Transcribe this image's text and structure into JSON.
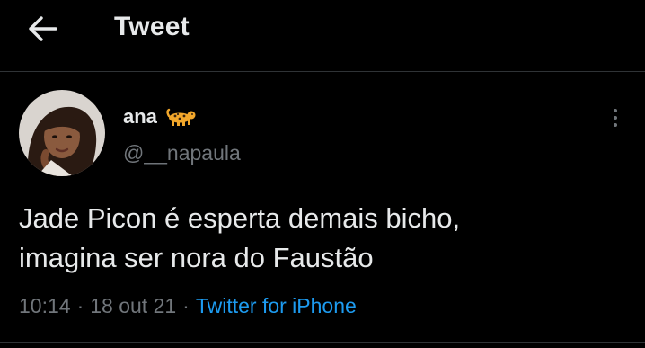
{
  "header": {
    "back_icon": "arrow-left-icon",
    "title": "Tweet"
  },
  "author": {
    "display_name": "ana",
    "name_emoji": "leopard-emoji",
    "handle": "@__napaula",
    "avatar": "avatar-photo"
  },
  "tweet": {
    "text": "Jade Picon é esperta demais bicho,\nimagina ser nora do Faustão",
    "time": "10:14",
    "separator": "·",
    "date": "18 out 21",
    "source": "Twitter for iPhone"
  },
  "more_icon": "more-vertical-icon",
  "colors": {
    "background": "#000000",
    "primary_text": "#e7e9ea",
    "secondary_text": "#71767b",
    "link": "#1d9bf0",
    "divider": "#2f3336"
  }
}
